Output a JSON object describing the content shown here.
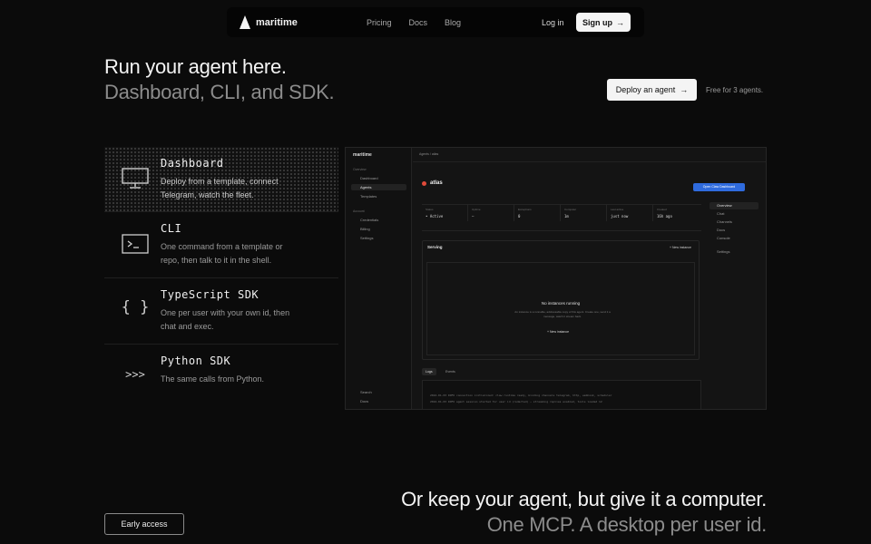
{
  "nav": {
    "brand": "maritime",
    "links": [
      "Pricing",
      "Docs",
      "Blog"
    ],
    "login": "Log in",
    "signup": "Sign up",
    "signup_arrow": "→"
  },
  "hero": {
    "line1": "Run your agent here.",
    "line2": "Dashboard, CLI, and SDK.",
    "deploy_button": "Deploy an agent",
    "deploy_arrow": "→",
    "note": "Free for 3 agents."
  },
  "options": [
    {
      "title": "Dashboard",
      "desc": "Deploy from a template, connect Telegram, watch the fleet.",
      "icon": "monitor-icon",
      "glyph": ""
    },
    {
      "title": "CLI",
      "desc": "One command from a template or repo, then talk to it in the shell.",
      "icon": "terminal-icon",
      "glyph": ""
    },
    {
      "title": "TypeScript SDK",
      "desc": "One per user with your own id, then chat and exec.",
      "icon": "braces-icon",
      "glyph": "{ }"
    },
    {
      "title": "Python SDK",
      "desc": "The same calls from Python.",
      "icon": "python-prompt-icon",
      "glyph": ">>>"
    }
  ],
  "mock": {
    "brand": "maritime",
    "sidebar_section_1": "Overview",
    "sidebar_items": [
      "Dashboard",
      "Agents",
      "Templates"
    ],
    "sidebar_section_2": "Account",
    "sidebar_items_2": [
      "Credentials",
      "Billing",
      "Settings"
    ],
    "sidebar_bottom": [
      "Search",
      "Docs"
    ],
    "breadcrumb": "Agents  /  atlas",
    "agent_name": "atlas",
    "open_button": "Open Claw Dashboard",
    "stats": [
      {
        "k": "Status",
        "v": "• Active"
      },
      {
        "k": "Uptime",
        "v": "—"
      },
      {
        "k": "Exceptions",
        "v": "0"
      },
      {
        "k": "Computer",
        "v": "1m"
      },
      {
        "k": "Last active",
        "v": "just now"
      },
      {
        "k": "Created",
        "v": "16h ago"
      }
    ],
    "right_nav": [
      "Overview",
      "Chat",
      "Channels",
      "Docs",
      "Console",
      "Settings"
    ],
    "serving_title": "Serving",
    "new_instance": "+ New instance",
    "no_instances": "No instances running",
    "no_instances_desc": "An instance is a runnable, addressable copy of this agent. Create one, send it a message, watch it stream back.",
    "new_instance_btn": "+ New instance",
    "log_tabs": [
      "Logs",
      "Events"
    ],
    "log_lines": [
      "2024-01-03  INFO   connection  initialized: claw runtime ready, binding channels telegram, http, webhook, scheduler",
      "2024-01-03  INFO   agent       session started for user id (redacted) — streaming replies enabled, tools loaded 12"
    ]
  },
  "bottom": {
    "line1": "Or keep your agent, but give it a computer.",
    "line2": "One MCP. A desktop per user id.",
    "early_access": "Early access"
  }
}
